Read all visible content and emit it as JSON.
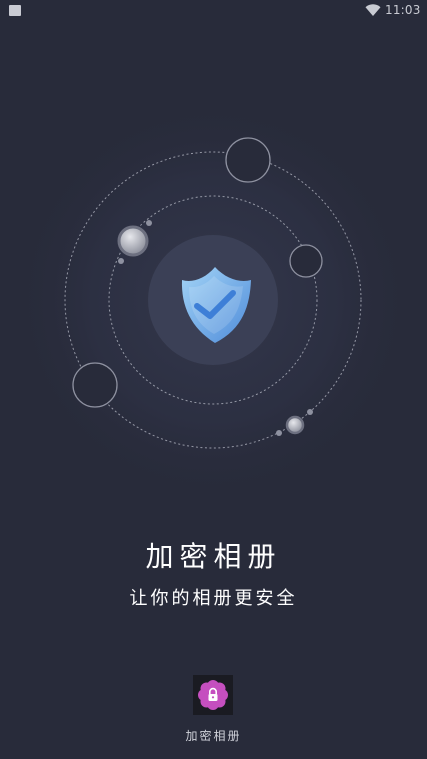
{
  "status_bar": {
    "time": "11:03"
  },
  "hero": {
    "center_icon": "shield-check-icon"
  },
  "intro": {
    "title": "加密相册",
    "subtitle": "让你的相册更安全"
  },
  "app": {
    "icon": "lock-flower-icon",
    "label": "加密相册"
  },
  "colors": {
    "background": "#282b3a",
    "shield": "#8fc8f5",
    "accent": "#c54fbf"
  }
}
